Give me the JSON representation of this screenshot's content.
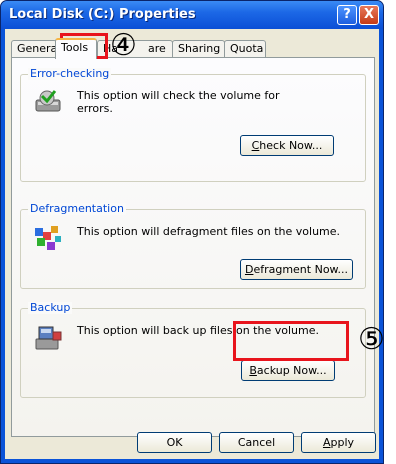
{
  "window": {
    "title": "Local Disk (C:) Properties",
    "help_label": "?",
    "close_label": "X"
  },
  "tabs": [
    {
      "label": "General",
      "shown": "Genera"
    },
    {
      "label": "Tools",
      "shown": "Tools"
    },
    {
      "label": "Hardware",
      "shown": "Ha"
    },
    {
      "label": "",
      "shown": "are"
    },
    {
      "label": "Sharing",
      "shown": "Sharing"
    },
    {
      "label": "Quota",
      "shown": "Quota"
    }
  ],
  "groups": {
    "error_checking": {
      "title": "Error-checking",
      "description_line1": "This option will check the volume for",
      "description_line2": "errors.",
      "button": {
        "accel": "C",
        "rest": "heck Now..."
      }
    },
    "defragmentation": {
      "title": "Defragmentation",
      "description": "This option will defragment files on the volume.",
      "button": {
        "accel": "D",
        "rest": "efragment Now..."
      }
    },
    "backup": {
      "title": "Backup",
      "description": "This option will back up files on the volume.",
      "button": {
        "accel": "B",
        "rest": "ackup Now..."
      }
    }
  },
  "footer": {
    "ok": "OK",
    "cancel": "Cancel",
    "apply": {
      "accel": "A",
      "rest": "pply"
    }
  },
  "annotations": {
    "step4": "④",
    "step5": "⑤",
    "highlight_color": "#e8141c"
  },
  "icons": [
    "help-icon",
    "close-icon",
    "disk-check-icon",
    "defragment-icon",
    "backup-icon"
  ]
}
